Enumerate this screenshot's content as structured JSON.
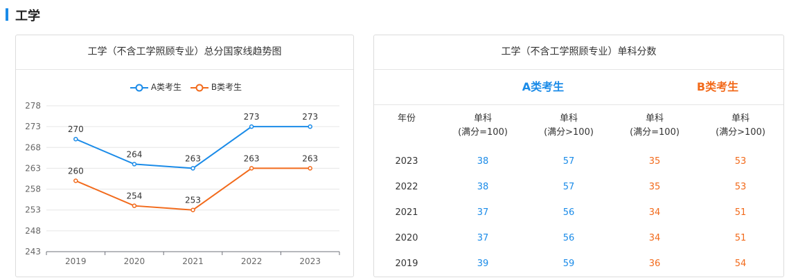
{
  "section": {
    "title": "工学"
  },
  "chart_data": {
    "type": "line",
    "title": "工学（不含工学照顾专业）总分国家线趋势图",
    "categories": [
      "2019",
      "2020",
      "2021",
      "2022",
      "2023"
    ],
    "series": [
      {
        "name": "A类考生",
        "values": [
          270,
          264,
          263,
          273,
          273
        ],
        "color": "#1a8be8"
      },
      {
        "name": "B类考生",
        "values": [
          260,
          254,
          253,
          263,
          263
        ],
        "color": "#f26a1b"
      }
    ],
    "y_ticks": [
      243,
      248,
      253,
      258,
      263,
      268,
      273,
      278
    ],
    "ylim": [
      243,
      278
    ],
    "grid": true,
    "legend_position": "top-center"
  },
  "table": {
    "title": "工学（不含工学照顾专业）单科分数",
    "group_a": "A类考生",
    "group_b": "B类考生",
    "header_year": "年份",
    "headers": [
      {
        "line1": "单科",
        "line2": "(满分=100)"
      },
      {
        "line1": "单科",
        "line2": "(满分>100)"
      },
      {
        "line1": "单科",
        "line2": "(满分=100)"
      },
      {
        "line1": "单科",
        "line2": "(满分>100)"
      }
    ],
    "rows": [
      {
        "year": "2023",
        "a100": "38",
        "aover": "57",
        "b100": "35",
        "bover": "53"
      },
      {
        "year": "2022",
        "a100": "38",
        "aover": "57",
        "b100": "35",
        "bover": "53"
      },
      {
        "year": "2021",
        "a100": "37",
        "aover": "56",
        "b100": "34",
        "bover": "51"
      },
      {
        "year": "2020",
        "a100": "37",
        "aover": "56",
        "b100": "34",
        "bover": "51"
      },
      {
        "year": "2019",
        "a100": "39",
        "aover": "59",
        "b100": "36",
        "bover": "54"
      }
    ],
    "colors": {
      "a": "#1a8be8",
      "b": "#f26a1b"
    }
  }
}
